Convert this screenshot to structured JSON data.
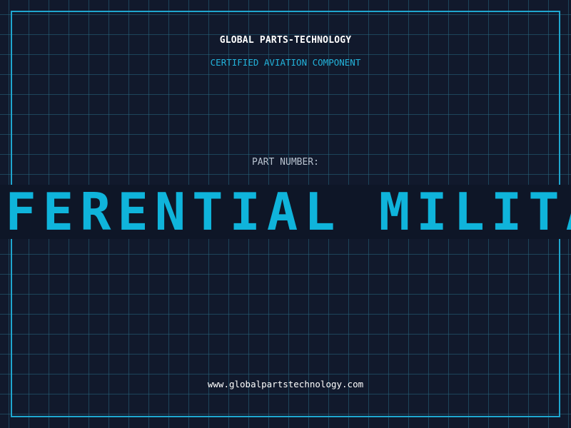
{
  "header": {
    "company": "GLOBAL PARTS-TECHNOLOGY",
    "subtitle": "CERTIFIED AVIATION COMPONENT"
  },
  "part": {
    "label": "PART NUMBER:",
    "value": "DIFFERENTIAL MILITARY"
  },
  "footer": {
    "website": "www.globalpartstechnology.com"
  },
  "colors": {
    "background": "#11192c",
    "accent": "#1fa6cf",
    "part_text": "#0fb4db"
  }
}
